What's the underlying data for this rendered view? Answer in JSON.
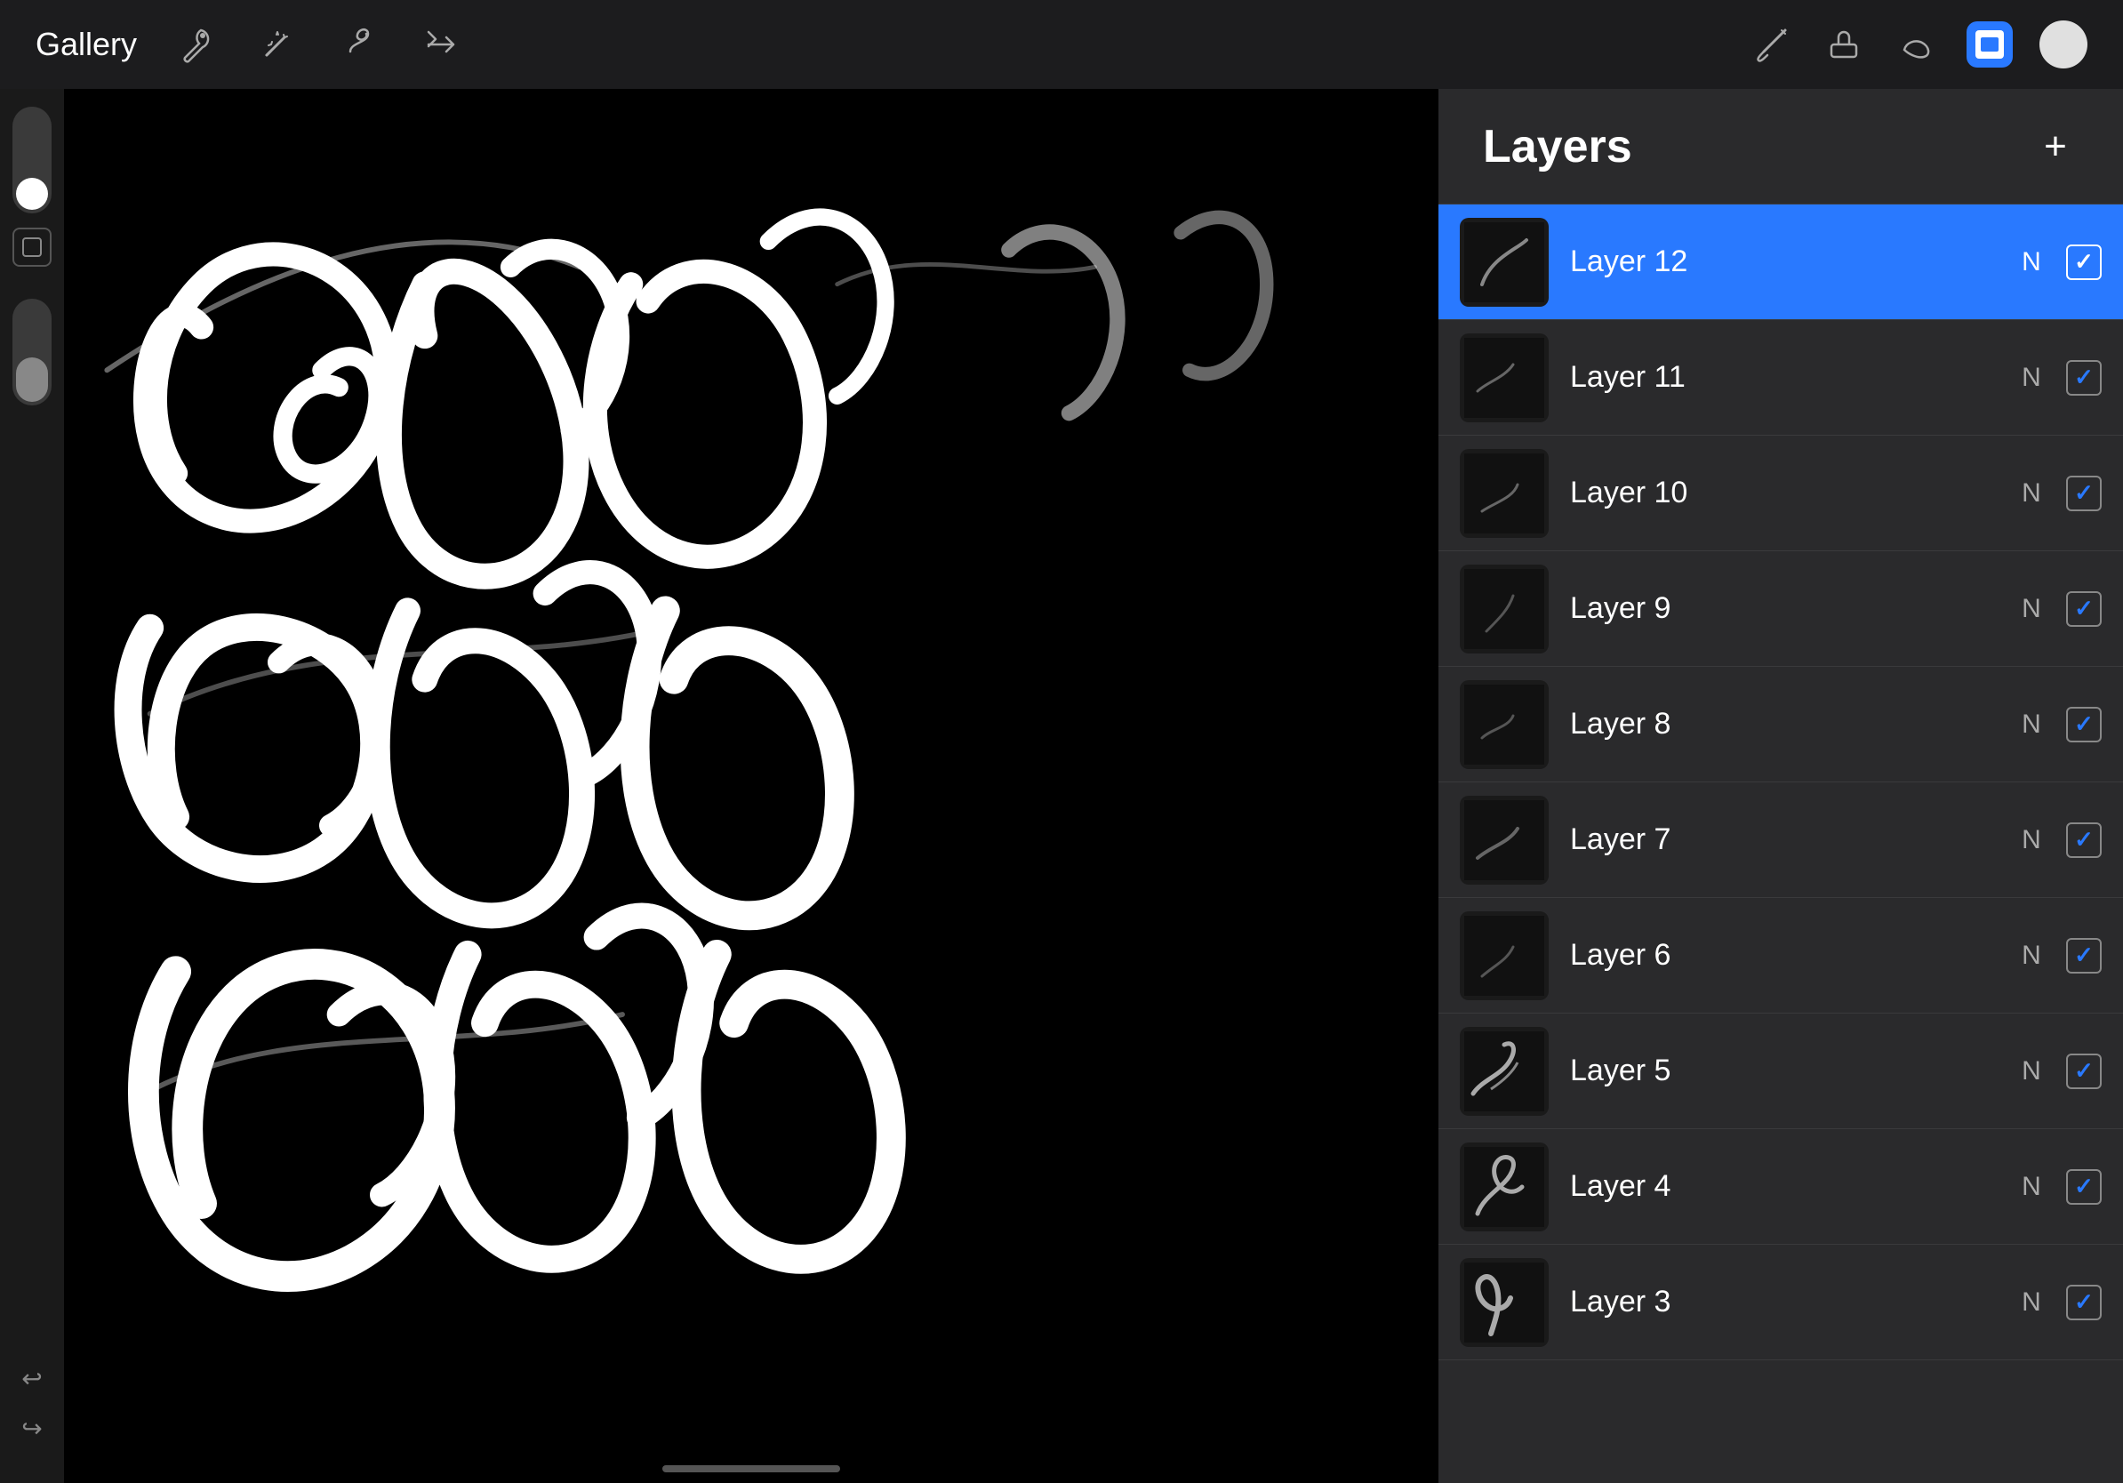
{
  "toolbar": {
    "gallery_label": "Gallery",
    "tools": [
      {
        "name": "wrench",
        "label": "Wrench",
        "active": false
      },
      {
        "name": "magic",
        "label": "Magic Wand",
        "active": false
      },
      {
        "name": "smudge",
        "label": "Smudge",
        "active": false
      },
      {
        "name": "arrow",
        "label": "Transform",
        "active": false
      }
    ],
    "right_tools": [
      {
        "name": "brush",
        "label": "Brush"
      },
      {
        "name": "eraser",
        "label": "Eraser"
      },
      {
        "name": "smudge-right",
        "label": "Smudge"
      },
      {
        "name": "layers-active",
        "label": "Layers",
        "active": true
      },
      {
        "name": "color",
        "label": "Color"
      }
    ]
  },
  "layers_panel": {
    "title": "Layers",
    "add_button": "+",
    "layers": [
      {
        "id": 12,
        "name": "Layer 12",
        "mode": "N",
        "visible": true,
        "active": true
      },
      {
        "id": 11,
        "name": "Layer 11",
        "mode": "N",
        "visible": true,
        "active": false
      },
      {
        "id": 10,
        "name": "Layer 10",
        "mode": "N",
        "visible": true,
        "active": false
      },
      {
        "id": 9,
        "name": "Layer 9",
        "mode": "N",
        "visible": true,
        "active": false
      },
      {
        "id": 8,
        "name": "Layer 8",
        "mode": "N",
        "visible": true,
        "active": false
      },
      {
        "id": 7,
        "name": "Layer 7",
        "mode": "N",
        "visible": true,
        "active": false
      },
      {
        "id": 6,
        "name": "Layer 6",
        "mode": "N",
        "visible": true,
        "active": false
      },
      {
        "id": 5,
        "name": "Layer 5",
        "mode": "N",
        "visible": true,
        "active": false
      },
      {
        "id": 4,
        "name": "Layer 4",
        "mode": "N",
        "visible": true,
        "active": false
      },
      {
        "id": 3,
        "name": "Layer 3",
        "mode": "N",
        "visible": true,
        "active": false
      }
    ]
  },
  "sidebar": {
    "undo_label": "↩",
    "redo_label": "↪"
  }
}
